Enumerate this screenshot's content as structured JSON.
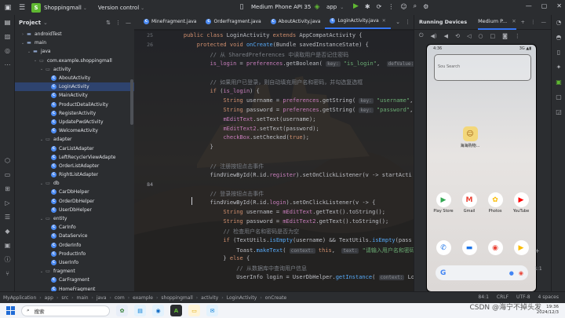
{
  "titlebar": {
    "project_badge": "S",
    "project_name": "Shoppingmall",
    "vcs": "Version control",
    "device": "Medium Phone API 35",
    "app": "app"
  },
  "project_panel": {
    "title": "Project",
    "tree": [
      {
        "label": "androidTest",
        "kind": "folder",
        "depth": 2,
        "arrow": "›"
      },
      {
        "label": "main",
        "kind": "folder",
        "depth": 2,
        "arrow": "⌄"
      },
      {
        "label": "java",
        "kind": "folder",
        "depth": 3,
        "arrow": "⌄"
      },
      {
        "label": "com.example.shoppingmall",
        "kind": "pkg",
        "depth": 4,
        "arrow": "⌄"
      },
      {
        "label": "activity",
        "kind": "pkg",
        "depth": 5,
        "arrow": "⌄"
      },
      {
        "label": "AboutActivity",
        "kind": "class",
        "depth": 6,
        "arrow": ""
      },
      {
        "label": "LoginActivity",
        "kind": "class",
        "depth": 6,
        "arrow": "",
        "selected": true
      },
      {
        "label": "MainActivity",
        "kind": "class",
        "depth": 6,
        "arrow": ""
      },
      {
        "label": "ProductDetailActivity",
        "kind": "class",
        "depth": 6,
        "arrow": ""
      },
      {
        "label": "RegisterActivity",
        "kind": "class",
        "depth": 6,
        "arrow": ""
      },
      {
        "label": "UpdatePwdActivity",
        "kind": "class",
        "depth": 6,
        "arrow": ""
      },
      {
        "label": "WelcomeActivity",
        "kind": "class",
        "depth": 6,
        "arrow": ""
      },
      {
        "label": "adapter",
        "kind": "pkg",
        "depth": 5,
        "arrow": "⌄"
      },
      {
        "label": "CarListAdapter",
        "kind": "class",
        "depth": 6,
        "arrow": ""
      },
      {
        "label": "LeftRecyclerViewAdapte",
        "kind": "class",
        "depth": 6,
        "arrow": ""
      },
      {
        "label": "OrderListAdapter",
        "kind": "class",
        "depth": 6,
        "arrow": ""
      },
      {
        "label": "RightListAdapter",
        "kind": "class",
        "depth": 6,
        "arrow": ""
      },
      {
        "label": "db",
        "kind": "pkg",
        "depth": 5,
        "arrow": "⌄"
      },
      {
        "label": "CarDbHelper",
        "kind": "class",
        "depth": 6,
        "arrow": ""
      },
      {
        "label": "OrderDbHelper",
        "kind": "class",
        "depth": 6,
        "arrow": ""
      },
      {
        "label": "UserDbHelper",
        "kind": "class",
        "depth": 6,
        "arrow": ""
      },
      {
        "label": "entity",
        "kind": "pkg",
        "depth": 5,
        "arrow": "⌄"
      },
      {
        "label": "CarInfo",
        "kind": "class",
        "depth": 6,
        "arrow": ""
      },
      {
        "label": "DataService",
        "kind": "class",
        "depth": 6,
        "arrow": ""
      },
      {
        "label": "OrderInfo",
        "kind": "class",
        "depth": 6,
        "arrow": ""
      },
      {
        "label": "ProductInfo",
        "kind": "class",
        "depth": 6,
        "arrow": ""
      },
      {
        "label": "UserInfo",
        "kind": "class",
        "depth": 6,
        "arrow": ""
      },
      {
        "label": "fragment",
        "kind": "pkg",
        "depth": 5,
        "arrow": "⌄"
      },
      {
        "label": "CarFragment",
        "kind": "class",
        "depth": 6,
        "arrow": ""
      },
      {
        "label": "HomeFragment",
        "kind": "class",
        "depth": 6,
        "arrow": ""
      }
    ]
  },
  "editor": {
    "tabs": [
      {
        "label": "MineFragment.java",
        "active": false
      },
      {
        "label": "OrderFragment.java",
        "active": false
      },
      {
        "label": "AboutActivity.java",
        "active": false
      },
      {
        "label": "LoginActivity.java",
        "active": true
      }
    ],
    "line_numbers": [
      "25",
      "26",
      "",
      "",
      "",
      "",
      "",
      "",
      "",
      "",
      "",
      "",
      "",
      "",
      "",
      "",
      "84",
      "",
      "",
      "",
      "",
      "",
      "",
      "",
      "",
      "",
      "",
      "",
      "",
      "",
      ""
    ],
    "hints": {
      "key": "key:",
      "def_value": "defValue:",
      "context": "context:",
      "text": "text:"
    },
    "lines": [
      {
        "parts": [
          {
            "t": "    "
          },
          {
            "t": "public class ",
            "c": "kw"
          },
          {
            "t": "LoginActivity "
          },
          {
            "t": "extends ",
            "c": "kw"
          },
          {
            "t": "AppCompatActivity {"
          }
        ]
      },
      {
        "parts": [
          {
            "t": "        "
          },
          {
            "t": "protected void ",
            "c": "kw"
          },
          {
            "t": "onCreate",
            "c": "fn"
          },
          {
            "t": "(Bundle savedInstanceState) {"
          }
        ]
      },
      {
        "parts": [
          {
            "t": "            "
          },
          {
            "t": "// 从 SharedPreferences 中读取用户是否记住密码",
            "c": "cm"
          }
        ]
      },
      {
        "parts": [
          {
            "t": "            "
          },
          {
            "t": "is_login",
            "c": "fld"
          },
          {
            "t": " = "
          },
          {
            "t": "preferences",
            "c": "fld"
          },
          {
            "t": ".getBoolean( "
          },
          {
            "t": "key:",
            "c": "hint"
          },
          {
            "t": " "
          },
          {
            "t": "\"is_login\"",
            "c": "str"
          },
          {
            "t": ",  "
          },
          {
            "t": "defValue:",
            "c": "hint"
          },
          {
            "t": " "
          },
          {
            "t": "fa",
            "c": "kw"
          }
        ]
      },
      {
        "parts": [
          {
            "t": " "
          }
        ]
      },
      {
        "parts": [
          {
            "t": "            "
          },
          {
            "t": "// 如果用户已登录，则自动填充用户名和密码，并勾选复选框",
            "c": "cm"
          }
        ]
      },
      {
        "parts": [
          {
            "t": "            "
          },
          {
            "t": "if ",
            "c": "kw"
          },
          {
            "t": "("
          },
          {
            "t": "is_login",
            "c": "fld"
          },
          {
            "t": ") {"
          }
        ]
      },
      {
        "parts": [
          {
            "t": "                "
          },
          {
            "t": "String ",
            "c": "kw"
          },
          {
            "t": "username = "
          },
          {
            "t": "preferences",
            "c": "fld"
          },
          {
            "t": ".getString( "
          },
          {
            "t": "key:",
            "c": "hint"
          },
          {
            "t": " "
          },
          {
            "t": "\"username\"",
            "c": "str"
          },
          {
            "t": ","
          }
        ]
      },
      {
        "parts": [
          {
            "t": "                "
          },
          {
            "t": "String ",
            "c": "kw"
          },
          {
            "t": "password = "
          },
          {
            "t": "preferences",
            "c": "fld"
          },
          {
            "t": ".getString( "
          },
          {
            "t": "key:",
            "c": "hint"
          },
          {
            "t": " "
          },
          {
            "t": "\"password\"",
            "c": "str"
          },
          {
            "t": ","
          }
        ]
      },
      {
        "parts": [
          {
            "t": "                "
          },
          {
            "t": "mEditText",
            "c": "fld"
          },
          {
            "t": ".setText(username);"
          }
        ]
      },
      {
        "parts": [
          {
            "t": "                "
          },
          {
            "t": "mEditText2",
            "c": "fld"
          },
          {
            "t": ".setText(password);"
          }
        ]
      },
      {
        "parts": [
          {
            "t": "                "
          },
          {
            "t": "checkBox",
            "c": "fld"
          },
          {
            "t": ".setChecked("
          },
          {
            "t": "true",
            "c": "kw"
          },
          {
            "t": ");"
          }
        ]
      },
      {
        "parts": [
          {
            "t": "            }"
          }
        ]
      },
      {
        "parts": [
          {
            "t": " "
          }
        ]
      },
      {
        "parts": [
          {
            "t": "            "
          },
          {
            "t": "// 注册按钮点击事件",
            "c": "cm"
          }
        ]
      },
      {
        "parts": [
          {
            "t": "            findViewById(R.id."
          },
          {
            "t": "register",
            "c": "fld"
          },
          {
            "t": ").setOnClickListener(v -> startActi"
          }
        ]
      },
      {
        "parts": [
          {
            "t": " "
          }
        ]
      },
      {
        "parts": [
          {
            "t": "            "
          },
          {
            "t": "// 登录按钮点击事件",
            "c": "cm"
          }
        ]
      },
      {
        "parts": [
          {
            "t": "            findViewById(R.id."
          },
          {
            "t": "login",
            "c": "fld"
          },
          {
            "t": ").setOnClickListener(v -> {"
          }
        ]
      },
      {
        "parts": [
          {
            "t": "                "
          },
          {
            "t": "String ",
            "c": "kw"
          },
          {
            "t": "username = "
          },
          {
            "t": "mEditText",
            "c": "fld"
          },
          {
            "t": ".getText().toString();"
          }
        ]
      },
      {
        "parts": [
          {
            "t": "                "
          },
          {
            "t": "String ",
            "c": "kw"
          },
          {
            "t": "password = "
          },
          {
            "t": "mEditText2",
            "c": "fld"
          },
          {
            "t": ".getText().toString();"
          }
        ]
      },
      {
        "parts": [
          {
            "t": "                "
          },
          {
            "t": "// 检查用户名和密码是否为空",
            "c": "cm"
          }
        ]
      },
      {
        "parts": [
          {
            "t": "                "
          },
          {
            "t": "if ",
            "c": "kw"
          },
          {
            "t": "(TextUtils."
          },
          {
            "t": "isEmpty",
            "c": "fn"
          },
          {
            "t": "(username) && TextUtils."
          },
          {
            "t": "isEmpty",
            "c": "fn"
          },
          {
            "t": "(pass"
          }
        ]
      },
      {
        "parts": [
          {
            "t": "                    Toast."
          },
          {
            "t": "makeText",
            "c": "fn"
          },
          {
            "t": "( "
          },
          {
            "t": "context:",
            "c": "hint"
          },
          {
            "t": " "
          },
          {
            "t": "this",
            "c": "kw"
          },
          {
            "t": ",  "
          },
          {
            "t": "text:",
            "c": "hint"
          },
          {
            "t": " "
          },
          {
            "t": "\"请输入用户名和密码\"",
            "c": "str"
          },
          {
            "t": ", T"
          }
        ]
      },
      {
        "parts": [
          {
            "t": "                } "
          },
          {
            "t": "else ",
            "c": "kw"
          },
          {
            "t": "{"
          }
        ]
      },
      {
        "parts": [
          {
            "t": "                    "
          },
          {
            "t": "// 从数据库中查询用户信息",
            "c": "cm"
          }
        ]
      },
      {
        "parts": [
          {
            "t": "                    UserInfo login = UserDbHelper."
          },
          {
            "t": "getInstance",
            "c": "fn"
          },
          {
            "t": "( "
          },
          {
            "t": "context:",
            "c": "hint"
          },
          {
            "t": " Log"
          }
        ]
      }
    ]
  },
  "running_devices": {
    "title": "Running Devices",
    "device_tab": "Medium P...",
    "phone": {
      "time": "4:36",
      "signal": "3G ▲▮",
      "search_hint": "Sou   Search",
      "shortcut_label": "海海购物...",
      "apps_row1": [
        {
          "label": "Play Store",
          "icon": "play-store-icon",
          "color": "#34a853",
          "glyph": "▶"
        },
        {
          "label": "Gmail",
          "icon": "gmail-icon",
          "color": "#ea4335",
          "glyph": "M"
        },
        {
          "label": "Photos",
          "icon": "photos-icon",
          "color": "#fbbc05",
          "glyph": "✿"
        },
        {
          "label": "YouTube",
          "icon": "youtube-icon",
          "color": "#ff0000",
          "glyph": "▶"
        }
      ],
      "apps_row2": [
        {
          "label": "",
          "icon": "phone-icon",
          "color": "#1a73e8",
          "glyph": "✆"
        },
        {
          "label": "",
          "icon": "messages-icon",
          "color": "#1a73e8",
          "glyph": "▬"
        },
        {
          "label": "",
          "icon": "chrome-icon",
          "color": "#ea4335",
          "glyph": "◉"
        },
        {
          "label": "",
          "icon": "camera-icon",
          "color": "#fbbc05",
          "glyph": "▶"
        }
      ],
      "google": "G"
    },
    "zoom": "1:1"
  },
  "statusbar": {
    "crumbs": [
      "MyApplication",
      "app",
      "src",
      "main",
      "java",
      "com",
      "example",
      "shoppingmall",
      "activity",
      "LoginActivity",
      "onCreate"
    ],
    "position": "84:1",
    "line_sep": "CRLF",
    "encoding": "UTF-8",
    "indent": "4 spaces"
  },
  "taskbar": {
    "search": "搜索",
    "time": "19:36",
    "date": "2024/12/3"
  },
  "watermark": "CSDN @海宁不掉头发",
  "colors": {
    "accent": "#3574f0",
    "run_green": "#5fb832",
    "editor_bg": "#1e1f22",
    "panel_bg": "#2b2d30"
  }
}
